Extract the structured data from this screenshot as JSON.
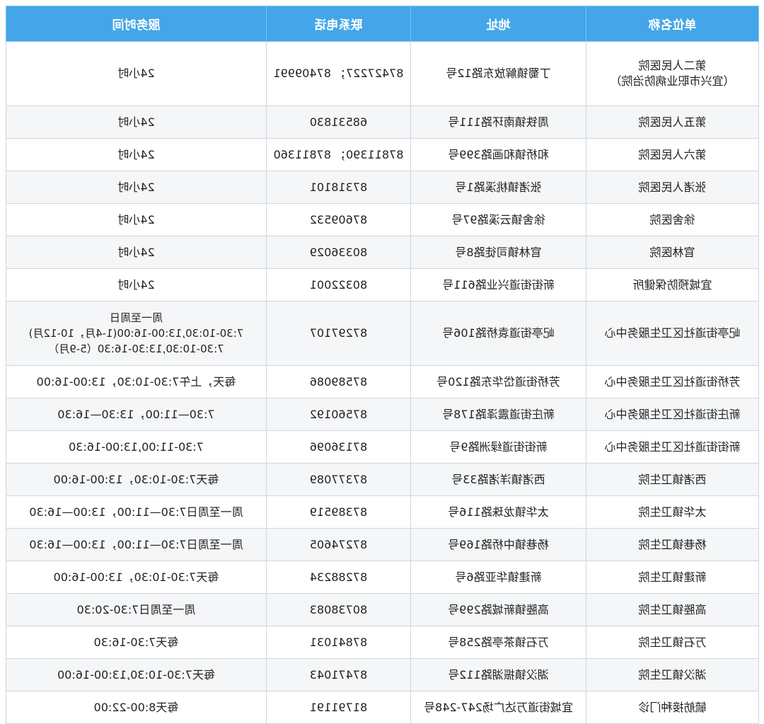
{
  "header": {
    "hours": "服务时间",
    "phone": "联系电话",
    "address": "地址",
    "name": "单位名称"
  },
  "rows": [
    {
      "hours": "24小时",
      "phone": "87427227； 87409991",
      "address": "丁蜀镇解放东路12号",
      "name": "第二人民医院\n（宜兴市职业病防治院）"
    },
    {
      "hours": "24小时",
      "phone": "68531830",
      "address": "周铁镇南环路111号",
      "name": "第五人民医院"
    },
    {
      "hours": "24小时",
      "phone": "87811390； 87811360",
      "address": "和桥镇和画路399号",
      "name": "第六人民医院"
    },
    {
      "hours": "24小时",
      "phone": "87318101",
      "address": "张渚镇桃溪路1号",
      "name": "张渚人民医院"
    },
    {
      "hours": "24小时",
      "phone": "87609532",
      "address": "徐舍镇云溪路97号",
      "name": "徐舍医院"
    },
    {
      "hours": "24小时",
      "phone": "80336029",
      "address": "官林镇司徒路8号",
      "name": "官林医院"
    },
    {
      "hours": "24小时",
      "phone": "80322001",
      "address": "新街街道兴业路611号",
      "name": "宜城预防保健所"
    },
    {
      "hours": "周一至周日\n7:30-10:30,13:00-16:00(1-4月，10-12月)\n7:30-10:30,13:30-16:30（5-9月）",
      "phone": "87297107",
      "address": "屺亭街道袁桥路106号",
      "name": "屺亭街道社区卫生服务中心"
    },
    {
      "hours": "每天，上午7:30-10:30，13:00-16:00",
      "phone": "87589086",
      "address": "芳桥街道岱华东路120号",
      "name": "芳桥街道社区卫生服务中心"
    },
    {
      "hours": "7:30—11:00，13:30—16:30",
      "phone": "87560192",
      "address": "新庄街道震泽路178号",
      "name": "新庄街道社区卫生服务中心"
    },
    {
      "hours": "7:30-11:00,13:00-16:30",
      "phone": "87136096",
      "address": "新街街道绿洲路9号",
      "name": "新街街道社区卫生服务中心"
    },
    {
      "hours": "每天7:30-10:30，13:00-16:00",
      "phone": "87377089",
      "address": "西渚镇洋渚路33号",
      "name": "西渚镇卫生院"
    },
    {
      "hours": "周一至周日7:30—11:00，13:00—16:30",
      "phone": "87389519",
      "address": "太华镇龙珠路116号",
      "name": "太华镇卫生院"
    },
    {
      "hours": "周一至周日7:30—11:00，13:00—16:30",
      "phone": "87274605",
      "address": "杨巷镇中桥路169号",
      "name": "杨巷镇卫生院"
    },
    {
      "hours": "每天7:30-10:30，13:00-16:00",
      "phone": "87288234",
      "address": "新建镇华亚路6号",
      "name": "新建镇卫生院"
    },
    {
      "hours": "周一至周日7:30-20:30",
      "phone": "80738083",
      "address": "高塍镇新城路299号",
      "name": "高塍镇卫生院"
    },
    {
      "hours": "每天7:30-16:30",
      "phone": "87841031",
      "address": "万石镇茶亭路258号",
      "name": "万石镇卫生院"
    },
    {
      "hours": "每天7:30-10:30,13:00-16:00",
      "phone": "87471043",
      "address": "湖㳇镇振湖路112号",
      "name": "湖㳇镇卫生院"
    },
    {
      "hours": "每天8:00-22:00",
      "phone": "81791191",
      "address": "宜城街道万达广场247-248号",
      "name": "毓舫接种门诊"
    }
  ]
}
